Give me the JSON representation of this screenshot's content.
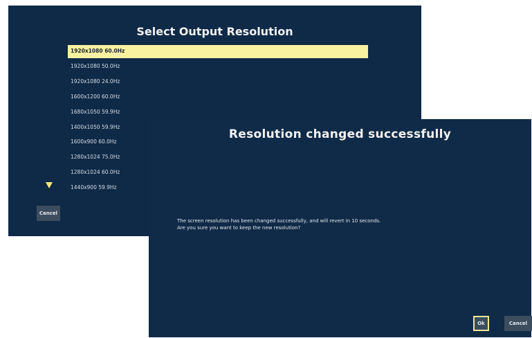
{
  "resolution_dialog": {
    "title": "Select Output Resolution",
    "resolutions": [
      "1920x1080 60.0Hz",
      "1920x1080 50.0Hz",
      "1920x1080 24.0Hz",
      "1600x1200 60.0Hz",
      "1680x1050 59.9Hz",
      "1400x1050 59.9Hz",
      "1600x900 60.0Hz",
      "1280x1024 75.0Hz",
      "1280x1024 60.0Hz",
      "1440x900 59.9Hz"
    ],
    "selected": "1920x1080 60.0Hz",
    "cancel_label": "Cancel",
    "scroll_icon": "triangle-down"
  },
  "confirm_dialog": {
    "title": "Resolution changed successfully",
    "message_line1": "The screen resolution has been changed successfully, and will revert in 10 seconds.",
    "message_line2": "Are you sure you want to keep the new resolution?",
    "ok_label": "Ok",
    "cancel_label": "Cancel"
  },
  "colors": {
    "panel_bg": "#0f2a47",
    "highlight": "#f8f2a0",
    "focus_border": "#f1e891",
    "button_bg": "#3c4d5e"
  }
}
